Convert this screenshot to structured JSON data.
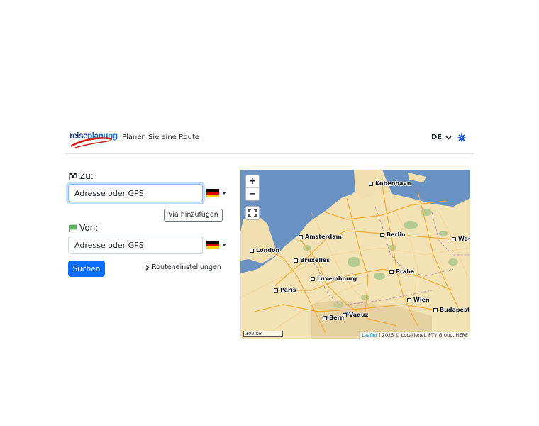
{
  "header": {
    "logo_text_a": "reise",
    "logo_text_b": "planung",
    "title": "Planen Sie eine Route",
    "language": "DE",
    "settings_icon": "gear-icon"
  },
  "form": {
    "to_label": "Zu:",
    "to_placeholder": "Adresse oder GPS",
    "via_button": "Via hinzufügen",
    "from_label": "Von:",
    "from_placeholder": "Adresse oder GPS",
    "search_button": "Suchen",
    "route_settings": "Routeneinstellungen",
    "selected_country": "DE"
  },
  "map": {
    "zoom_in": "+",
    "zoom_out": "−",
    "scale": "300 km",
    "attribution_leaflet": "Leaflet",
    "attribution_rest": "| 2025 © Locatienet, PTV Group, HERE",
    "cities": [
      "København",
      "Berlin",
      "Amsterdam",
      "London",
      "Bruxelles",
      "Luxembourg",
      "Praha",
      "Paris",
      "Wien",
      "Vaduz",
      "Bern",
      "Budapest",
      "Wars"
    ]
  },
  "colors": {
    "primary": "#0d6efd",
    "sea": "#6a93c4",
    "land": "#f3e2b3"
  }
}
